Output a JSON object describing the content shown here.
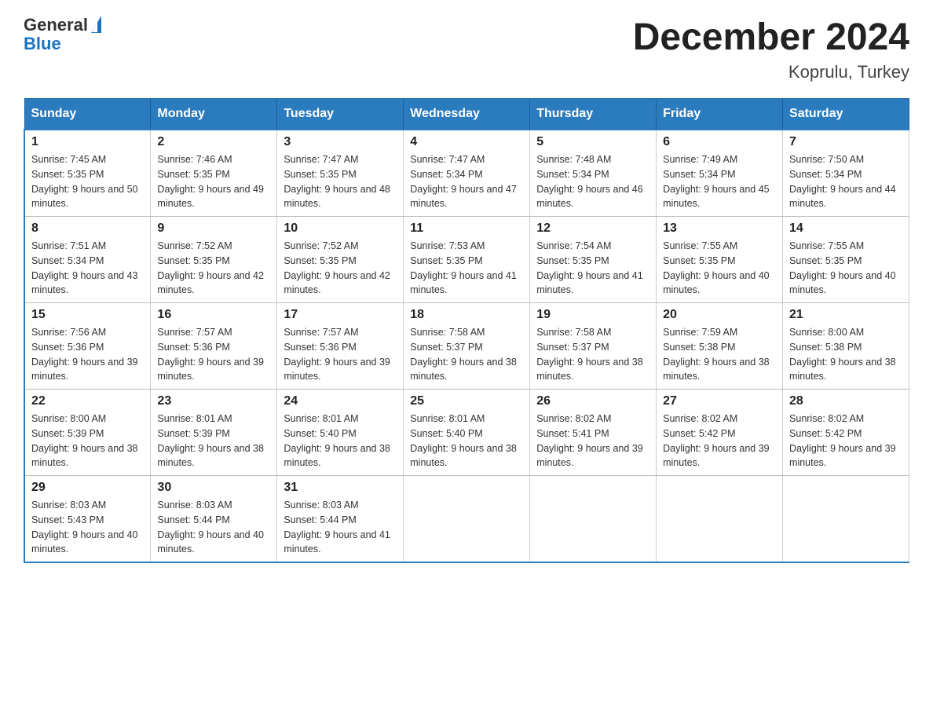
{
  "logo": {
    "text_general": "General",
    "text_blue": "Blue"
  },
  "title": "December 2024",
  "subtitle": "Koprulu, Turkey",
  "weekdays": [
    "Sunday",
    "Monday",
    "Tuesday",
    "Wednesday",
    "Thursday",
    "Friday",
    "Saturday"
  ],
  "weeks": [
    [
      {
        "day": "1",
        "sunrise": "7:45 AM",
        "sunset": "5:35 PM",
        "daylight": "9 hours and 50 minutes."
      },
      {
        "day": "2",
        "sunrise": "7:46 AM",
        "sunset": "5:35 PM",
        "daylight": "9 hours and 49 minutes."
      },
      {
        "day": "3",
        "sunrise": "7:47 AM",
        "sunset": "5:35 PM",
        "daylight": "9 hours and 48 minutes."
      },
      {
        "day": "4",
        "sunrise": "7:47 AM",
        "sunset": "5:34 PM",
        "daylight": "9 hours and 47 minutes."
      },
      {
        "day": "5",
        "sunrise": "7:48 AM",
        "sunset": "5:34 PM",
        "daylight": "9 hours and 46 minutes."
      },
      {
        "day": "6",
        "sunrise": "7:49 AM",
        "sunset": "5:34 PM",
        "daylight": "9 hours and 45 minutes."
      },
      {
        "day": "7",
        "sunrise": "7:50 AM",
        "sunset": "5:34 PM",
        "daylight": "9 hours and 44 minutes."
      }
    ],
    [
      {
        "day": "8",
        "sunrise": "7:51 AM",
        "sunset": "5:34 PM",
        "daylight": "9 hours and 43 minutes."
      },
      {
        "day": "9",
        "sunrise": "7:52 AM",
        "sunset": "5:35 PM",
        "daylight": "9 hours and 42 minutes."
      },
      {
        "day": "10",
        "sunrise": "7:52 AM",
        "sunset": "5:35 PM",
        "daylight": "9 hours and 42 minutes."
      },
      {
        "day": "11",
        "sunrise": "7:53 AM",
        "sunset": "5:35 PM",
        "daylight": "9 hours and 41 minutes."
      },
      {
        "day": "12",
        "sunrise": "7:54 AM",
        "sunset": "5:35 PM",
        "daylight": "9 hours and 41 minutes."
      },
      {
        "day": "13",
        "sunrise": "7:55 AM",
        "sunset": "5:35 PM",
        "daylight": "9 hours and 40 minutes."
      },
      {
        "day": "14",
        "sunrise": "7:55 AM",
        "sunset": "5:35 PM",
        "daylight": "9 hours and 40 minutes."
      }
    ],
    [
      {
        "day": "15",
        "sunrise": "7:56 AM",
        "sunset": "5:36 PM",
        "daylight": "9 hours and 39 minutes."
      },
      {
        "day": "16",
        "sunrise": "7:57 AM",
        "sunset": "5:36 PM",
        "daylight": "9 hours and 39 minutes."
      },
      {
        "day": "17",
        "sunrise": "7:57 AM",
        "sunset": "5:36 PM",
        "daylight": "9 hours and 39 minutes."
      },
      {
        "day": "18",
        "sunrise": "7:58 AM",
        "sunset": "5:37 PM",
        "daylight": "9 hours and 38 minutes."
      },
      {
        "day": "19",
        "sunrise": "7:58 AM",
        "sunset": "5:37 PM",
        "daylight": "9 hours and 38 minutes."
      },
      {
        "day": "20",
        "sunrise": "7:59 AM",
        "sunset": "5:38 PM",
        "daylight": "9 hours and 38 minutes."
      },
      {
        "day": "21",
        "sunrise": "8:00 AM",
        "sunset": "5:38 PM",
        "daylight": "9 hours and 38 minutes."
      }
    ],
    [
      {
        "day": "22",
        "sunrise": "8:00 AM",
        "sunset": "5:39 PM",
        "daylight": "9 hours and 38 minutes."
      },
      {
        "day": "23",
        "sunrise": "8:01 AM",
        "sunset": "5:39 PM",
        "daylight": "9 hours and 38 minutes."
      },
      {
        "day": "24",
        "sunrise": "8:01 AM",
        "sunset": "5:40 PM",
        "daylight": "9 hours and 38 minutes."
      },
      {
        "day": "25",
        "sunrise": "8:01 AM",
        "sunset": "5:40 PM",
        "daylight": "9 hours and 38 minutes."
      },
      {
        "day": "26",
        "sunrise": "8:02 AM",
        "sunset": "5:41 PM",
        "daylight": "9 hours and 39 minutes."
      },
      {
        "day": "27",
        "sunrise": "8:02 AM",
        "sunset": "5:42 PM",
        "daylight": "9 hours and 39 minutes."
      },
      {
        "day": "28",
        "sunrise": "8:02 AM",
        "sunset": "5:42 PM",
        "daylight": "9 hours and 39 minutes."
      }
    ],
    [
      {
        "day": "29",
        "sunrise": "8:03 AM",
        "sunset": "5:43 PM",
        "daylight": "9 hours and 40 minutes."
      },
      {
        "day": "30",
        "sunrise": "8:03 AM",
        "sunset": "5:44 PM",
        "daylight": "9 hours and 40 minutes."
      },
      {
        "day": "31",
        "sunrise": "8:03 AM",
        "sunset": "5:44 PM",
        "daylight": "9 hours and 41 minutes."
      },
      null,
      null,
      null,
      null
    ]
  ]
}
